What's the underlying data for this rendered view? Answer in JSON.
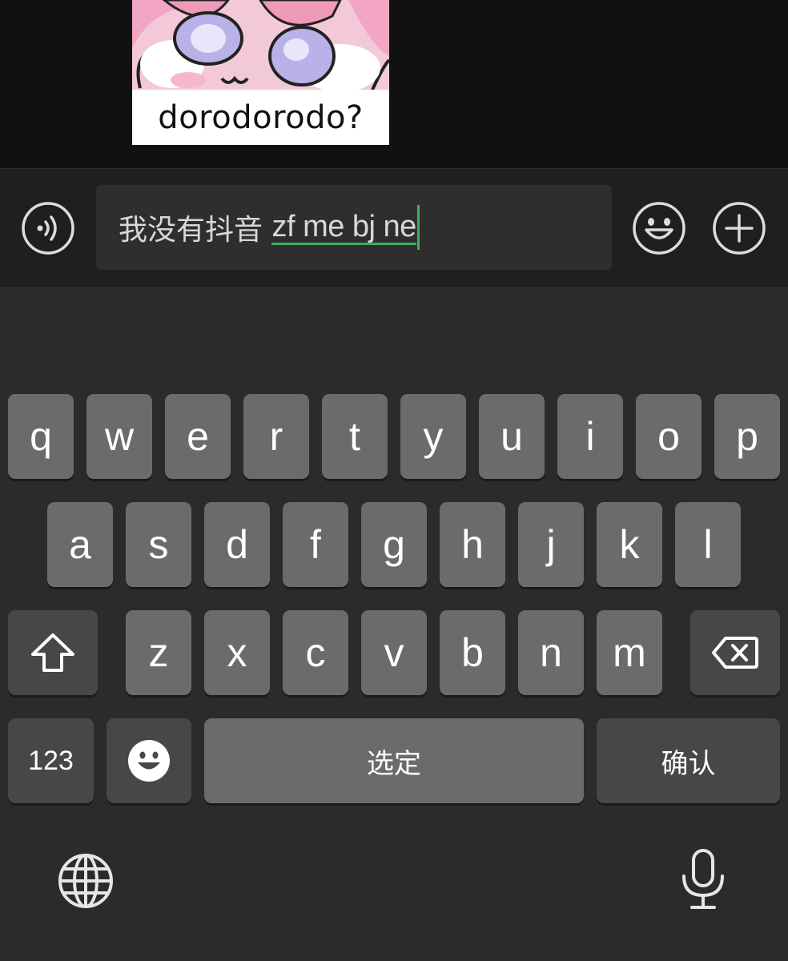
{
  "sticker": {
    "caption": "dorodorodo?"
  },
  "input_bar": {
    "voice_icon": "voice-wave-icon",
    "typed_text": "我没有抖音 ",
    "composing_text": "zf me bj ne",
    "emoji_icon": "smiley-face-icon",
    "plus_icon": "plus-circle-icon"
  },
  "keyboard": {
    "row1": [
      "q",
      "w",
      "e",
      "r",
      "t",
      "y",
      "u",
      "i",
      "o",
      "p"
    ],
    "row2": [
      "a",
      "s",
      "d",
      "f",
      "g",
      "h",
      "j",
      "k",
      "l"
    ],
    "row3": [
      "z",
      "x",
      "c",
      "v",
      "b",
      "n",
      "m"
    ],
    "shift_icon": "shift-arrow-icon",
    "delete_icon": "backspace-icon",
    "numbers_label": "123",
    "emoji_key_icon": "emoji-icon",
    "space_label": "选定",
    "confirm_label": "确认",
    "globe_icon": "globe-icon",
    "mic_icon": "microphone-icon"
  },
  "colors": {
    "key": "#6b6b6b",
    "special_key": "#474747",
    "keyboard_bg": "#2b2b2b",
    "composing_underline": "#3fae5b"
  }
}
